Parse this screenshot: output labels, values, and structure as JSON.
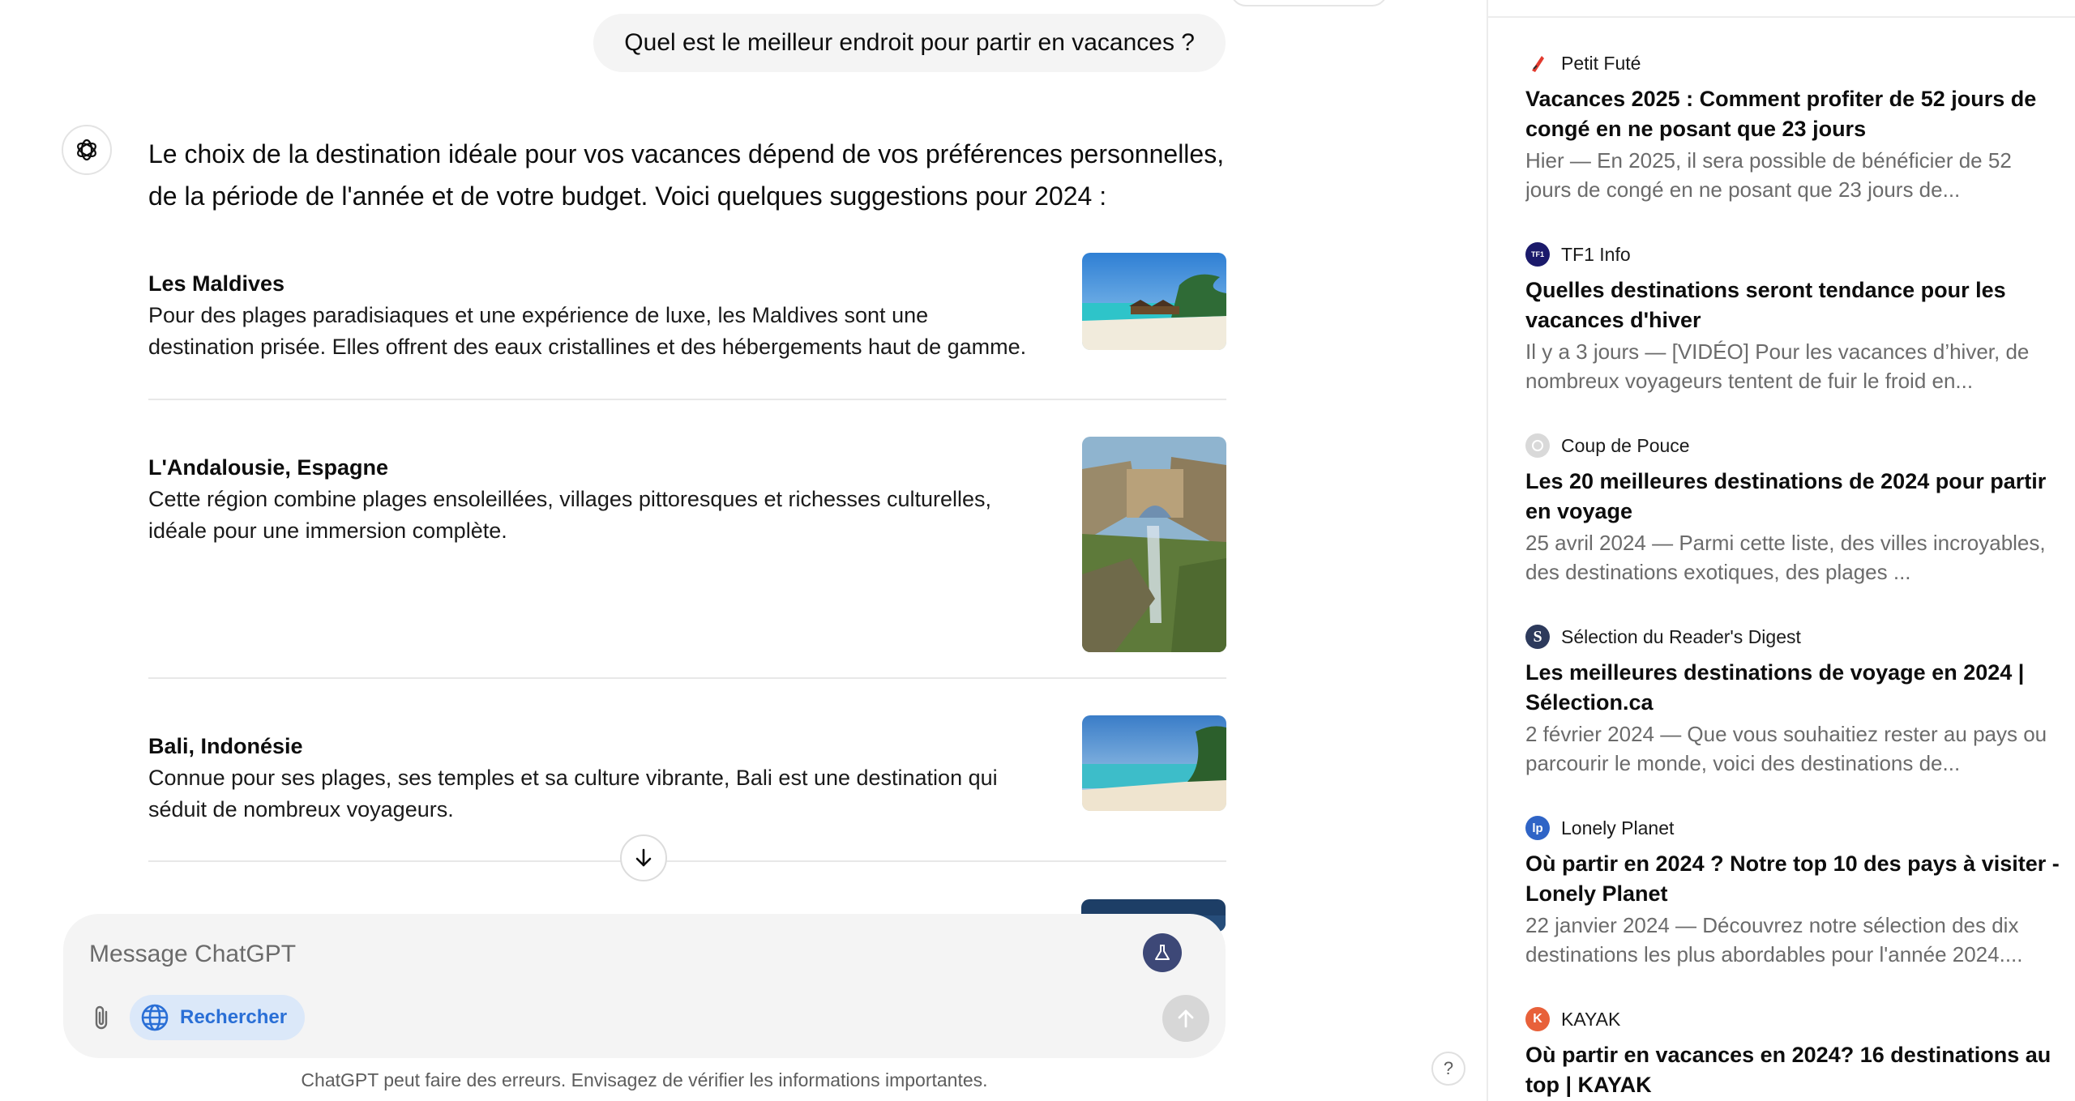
{
  "chat": {
    "user_message": "Quel est le meilleur endroit pour partir en vacances ?",
    "assistant_intro": "Le choix de la destination idéale pour vos vacances dépend de vos préférences personnelles, de la période de l'année et de votre budget. Voici quelques suggestions pour 2024 :",
    "destinations": [
      {
        "title": "Les Maldives",
        "description": "Pour des plages paradisiaques et une expérience de luxe, les Maldives sont une destination prisée. Elles offrent des eaux cristallines et des hébergements haut de gamme.",
        "image": "tropical-beach-overwater-huts"
      },
      {
        "title": "L'Andalousie, Espagne",
        "description": "Cette région combine plages ensoleillées, villages pittoresques et richesses culturelles, idéale pour une immersion complète.",
        "image": "ronda-bridge-cliff-waterfall"
      },
      {
        "title": "Bali, Indonésie",
        "description": "Connue pour ses plages, ses temples et sa culture vibrante, Bali est une destination qui séduit de nombreux voyageurs.",
        "image": "beach-turquoise-sea"
      }
    ]
  },
  "composer": {
    "placeholder": "Message ChatGPT",
    "search_label": "Rechercher",
    "icons": [
      "flask-icon",
      "paperclip-icon",
      "globe-icon",
      "arrow-up-icon"
    ]
  },
  "disclaimer": "ChatGPT peut faire des erreurs. Envisagez de vérifier les informations importantes.",
  "help_label": "?",
  "sources": [
    {
      "site": "Petit Futé",
      "favicon": "petit-fute-icon",
      "favicon_color": "#ffffff",
      "title": "Vacances 2025 : Comment profiter de 52 jours de congé en ne posant que 23 jours",
      "snippet": "Hier — En 2025, il sera possible de bénéficier de 52 jours de congé en ne posant que 23 jours de..."
    },
    {
      "site": "TF1 Info",
      "favicon": "tf1-info-icon",
      "favicon_color": "#1b1a6b",
      "title": "Quelles destinations seront tendance pour les vacances d'hiver",
      "snippet": "Il y a 3 jours — [VIDÉO] Pour les vacances d’hiver, de nombreux voyageurs tentent de fuir le froid en..."
    },
    {
      "site": "Coup de Pouce",
      "favicon": "coup-de-pouce-icon",
      "favicon_color": "#d9d9d9",
      "title": "Les 20 meilleures destinations de 2024 pour partir en voyage",
      "snippet": "25 avril 2024 — Parmi cette liste, des villes incroyables, des destinations exotiques, des plages ..."
    },
    {
      "site": "Sélection du Reader's Digest",
      "favicon": "readers-digest-icon",
      "favicon_color": "#2d3a5c",
      "title": "Les meilleures destinations de voyage en 2024 | Sélection.ca",
      "snippet": "2 février 2024 — Que vous souhaitiez rester au pays ou parcourir le monde, voici des destinations de..."
    },
    {
      "site": "Lonely Planet",
      "favicon": "lonely-planet-icon",
      "favicon_color": "#2f64c6",
      "title": "Où partir en 2024 ? Notre top 10 des pays à visiter - Lonely Planet",
      "snippet": "22 janvier 2024 — Découvrez notre sélection des dix destinations les plus abordables pour l'année 2024...."
    },
    {
      "site": "KAYAK",
      "favicon": "kayak-icon",
      "favicon_color": "#e8613a",
      "title": "Où partir en vacances en 2024? 16 destinations au top | KAYAK",
      "snippet": ""
    }
  ]
}
